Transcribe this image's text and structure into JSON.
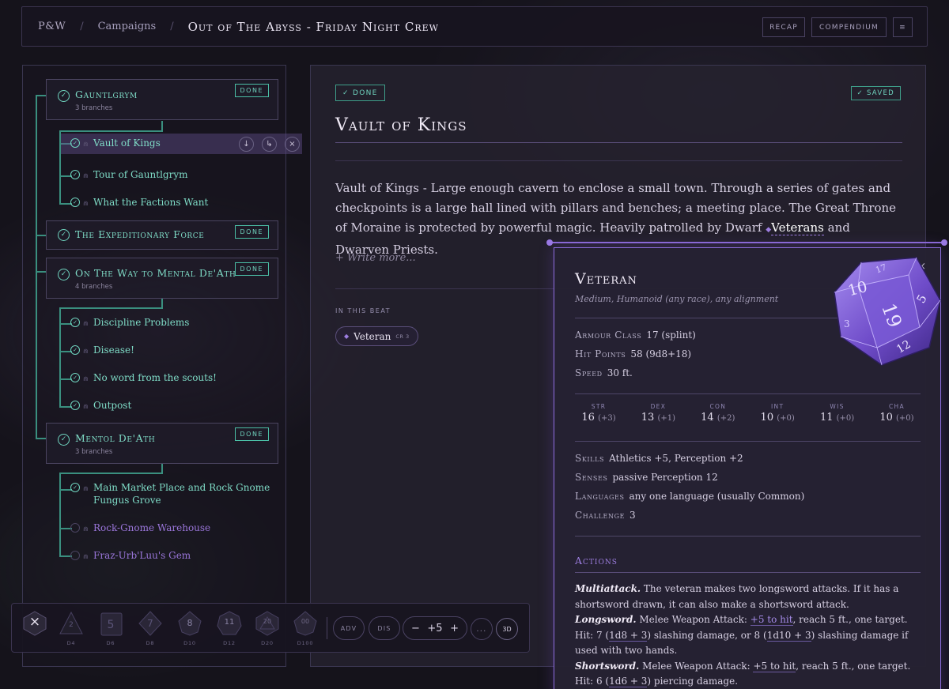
{
  "header": {
    "brand": "P&W",
    "campaigns": "Campaigns",
    "campaign_title": "Out of The Abyss - Friday Night Crew",
    "buttons": [
      "RECAP",
      "COMPENDIUM",
      "≡"
    ]
  },
  "sidebar": {
    "groups": [
      {
        "name": "Gauntlgrym",
        "sub": "3 branches",
        "status": "DONE"
      },
      {
        "name": "The Expeditionary Force",
        "status": "DONE"
      },
      {
        "name": "On The Way to Mental De'Ath",
        "sub": "4 branches",
        "status": "DONE"
      },
      {
        "name": "Mentol De'Ath",
        "sub": "3 branches",
        "status": "DONE"
      }
    ],
    "items": [
      {
        "label": "Vault of Kings"
      },
      {
        "label": "Tour of Gauntlgrym"
      },
      {
        "label": "What the Factions Want"
      },
      {
        "label": "Discipline Problems"
      },
      {
        "label": "Disease!"
      },
      {
        "label": "No word from the scouts!"
      },
      {
        "label": "Outpost"
      },
      {
        "label": "Main Market Place and Rock Gnome",
        "label2": "Fungus Grove"
      },
      {
        "label": "Rock-Gnome Warehouse"
      },
      {
        "label": "Fraz-Urb'Luu's Gem"
      }
    ],
    "row_actions": [
      "↓",
      "↳",
      "×"
    ],
    "check_glyph": "✓",
    "lock_glyph": "⋒"
  },
  "main": {
    "status": "✓ DONE",
    "saved": "✓ SAVED",
    "title": "Vault of Kings",
    "desc_pre": "Vault of Kings - Large enough cavern to enclose a small town. Through a series of gates and checkpoints is a large hall lined with pillars and benches; a meeting place. The Great Throne of Moraine is protected by powerful magic. Heavily patrolled by Dwarf ",
    "desc_link": "Veterans",
    "desc_post": " and Dwarven Priests.",
    "write_more": "+ Write more...",
    "in_beat_label": "IN THIS BEAT",
    "chip": {
      "name": "Veteran",
      "cr": "CR 3"
    }
  },
  "statblock": {
    "name": "Veteran",
    "type": "Medium, Humanoid (any race), any alignment",
    "ac_label": "Armour Class",
    "ac": "17 (splint)",
    "hp_label": "Hit Points",
    "hp": "58 (9d8+18)",
    "speed_label": "Speed",
    "speed": "30 ft.",
    "abilities": [
      {
        "name": "STR",
        "score": "16",
        "mod": "(+3)"
      },
      {
        "name": "DEX",
        "score": "13",
        "mod": "(+1)"
      },
      {
        "name": "CON",
        "score": "14",
        "mod": "(+2)"
      },
      {
        "name": "INT",
        "score": "10",
        "mod": "(+0)"
      },
      {
        "name": "WIS",
        "score": "11",
        "mod": "(+0)"
      },
      {
        "name": "CHA",
        "score": "10",
        "mod": "(+0)"
      }
    ],
    "skills_label": "Skills",
    "skills": "Athletics +5, Perception +2",
    "senses_label": "Senses",
    "senses": "passive Perception 12",
    "languages_label": "Languages",
    "languages": "any one language (usually Common)",
    "challenge_label": "Challenge",
    "challenge": "3",
    "actions_label": "Actions",
    "multi_name": "Multiattack.",
    "multi_text": " The veteran makes two longsword attacks. If it has a shortsword drawn, it can also make a shortsword attack.",
    "long_name": "Longsword.",
    "long_pre": " Melee Weapon Attack: ",
    "long_hit": "+5 to hit",
    "long_mid": ", reach 5 ft., one target. Hit: 7 (",
    "long_dmg1": "1d8 + 3",
    "long_mid2": ") slashing damage, or 8 (",
    "long_dmg2": "1d10 + 3",
    "long_post": ") slashing damage if used with two hands.",
    "short_name": "Shortsword.",
    "short_pre": " Melee Weapon Attack: ",
    "short_hit": "+5 to hit",
    "short_mid": ", reach 5 ft., one target. Hit: 6 (",
    "short_dmg": "1d6 + 3",
    "short_post": ") piercing damage.",
    "close": "×",
    "d20_faces": [
      "10",
      "19",
      "5",
      "12",
      "3",
      "17"
    ]
  },
  "dice_tray": {
    "close": "×",
    "dice": [
      {
        "label": "D4",
        "num": "2"
      },
      {
        "label": "D6",
        "num": "5"
      },
      {
        "label": "D8",
        "num": "7"
      },
      {
        "label": "D10",
        "num": "8"
      },
      {
        "label": "D12",
        "num": "11"
      },
      {
        "label": "D20",
        "num": "20"
      },
      {
        "label": "D100",
        "num": "00"
      }
    ],
    "adv": "ADV",
    "dis": "DIS",
    "minus": "−",
    "modifier": "+5",
    "plus": "+",
    "more": "...",
    "three_d": "3D"
  },
  "colors": {
    "accent": "#9d7ee0",
    "done": "#6fd3be",
    "bg": "#15131b"
  }
}
